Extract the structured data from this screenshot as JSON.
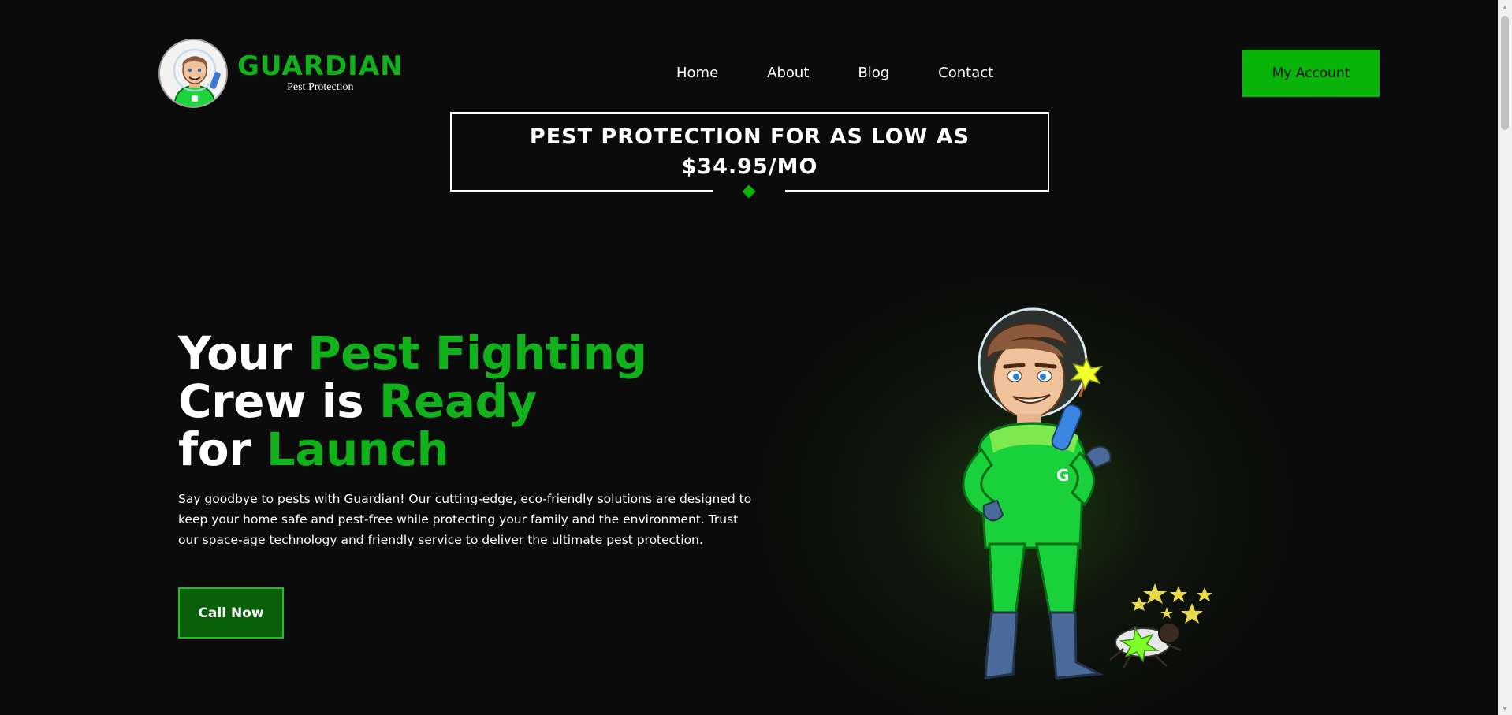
{
  "header": {
    "logo": {
      "name": "GUARDIAN",
      "tagline": "Pest Protection"
    },
    "nav": [
      {
        "label": "Home"
      },
      {
        "label": "About"
      },
      {
        "label": "Blog"
      },
      {
        "label": "Contact"
      }
    ],
    "account_label": "My Account"
  },
  "promo": {
    "line1": "PEST PROTECTION FOR AS LOW AS",
    "line2": "$34.95/MO"
  },
  "hero": {
    "title": {
      "w1": "Your ",
      "g1": "Pest Fighting",
      "w2": "Crew is ",
      "g2": "Ready",
      "w3": "for ",
      "g3": "Launch"
    },
    "description": "Say goodbye to pests with Guardian! Our cutting-edge, eco-friendly solutions are designed to keep your home safe and pest-free while protecting your family and the environment. Trust our space-age technology and friendly service to deliver the ultimate pest protection.",
    "cta_label": "Call Now"
  },
  "icons": {
    "logo": "astronaut-mascot-icon",
    "mascot": "astronaut-exterminator-illustration",
    "bug": "dead-bug-icon",
    "scroll_up": "triangle-up-icon",
    "scroll_down": "triangle-down-icon"
  },
  "colors": {
    "brand_green": "#11b11b",
    "button_green": "#08b408",
    "cta_dark_green": "#0a5f0a",
    "background": "#0b0b0b",
    "text": "#ffffff"
  }
}
